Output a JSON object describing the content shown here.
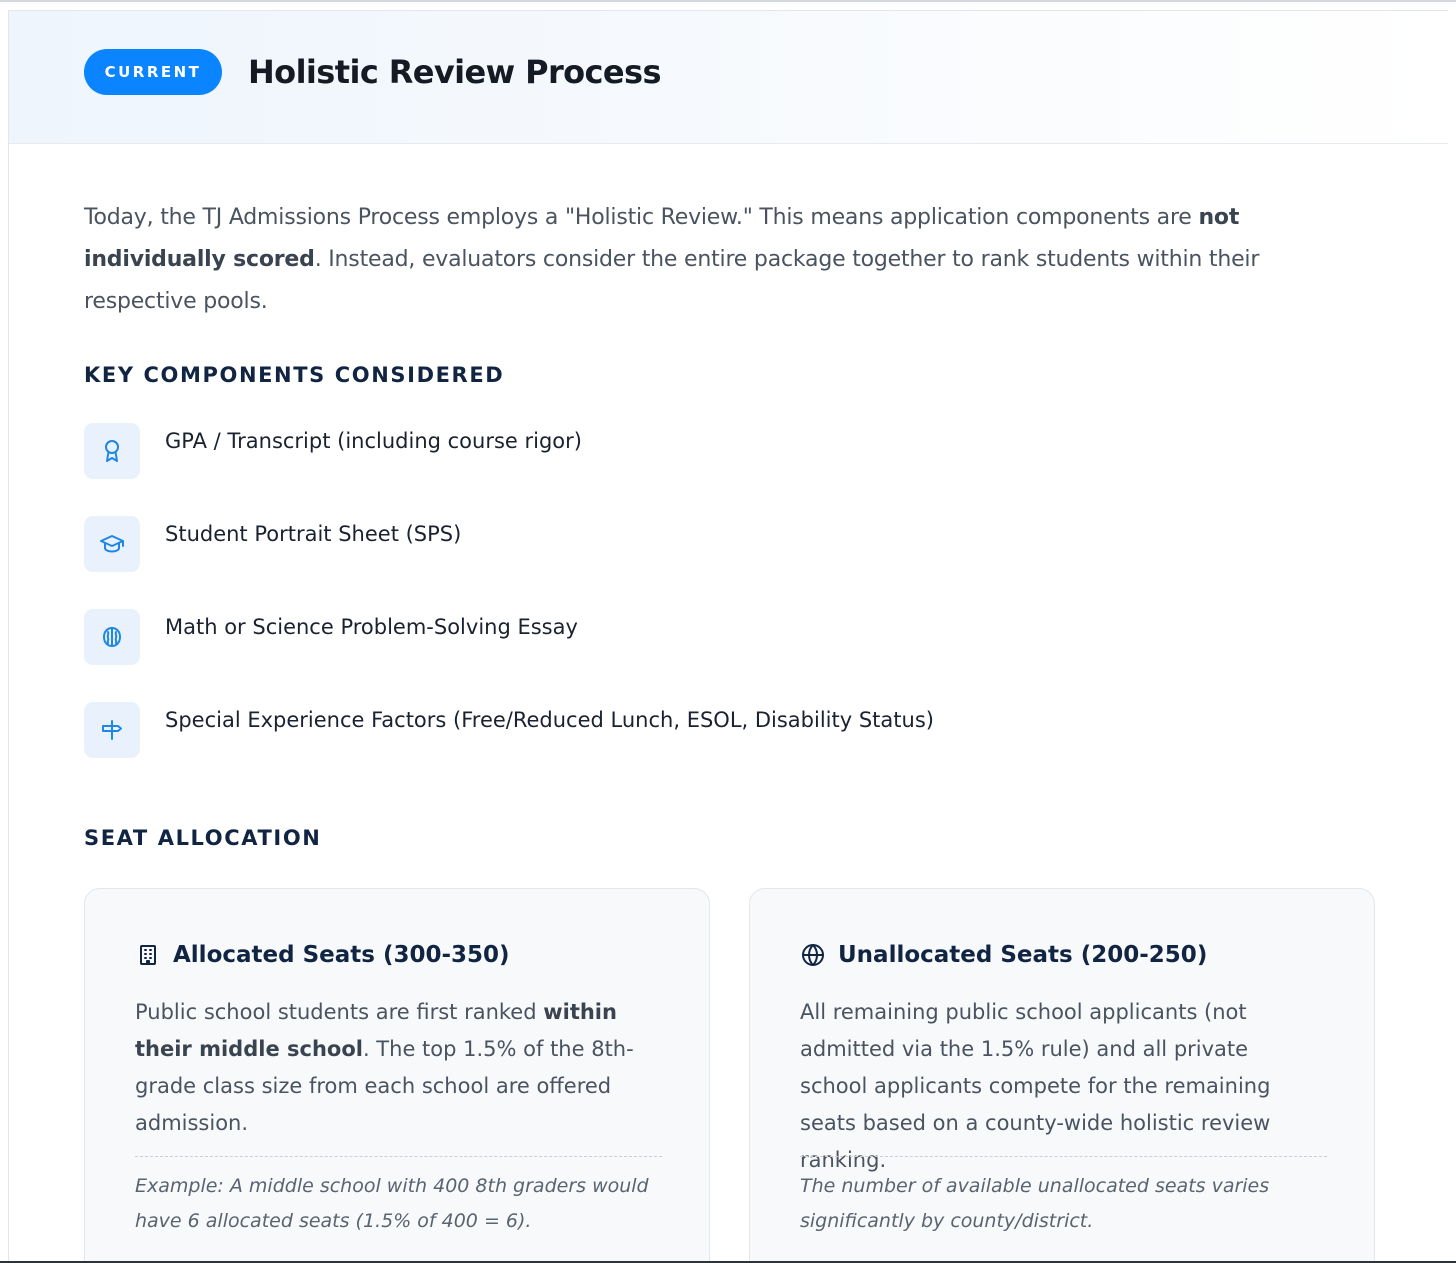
{
  "header": {
    "badge": "CURRENT",
    "title": "Holistic Review Process"
  },
  "intro": {
    "part1": "Today, the TJ Admissions Process employs a \"Holistic Review.\" This means application components are ",
    "bold": "not individually scored",
    "part2": ". Instead, evaluators consider the entire package together to rank students within their respective pools."
  },
  "key_components": {
    "heading": "KEY COMPONENTS CONSIDERED",
    "items": [
      {
        "icon": "award-ribbon-icon",
        "label": "GPA / Transcript (including course rigor)"
      },
      {
        "icon": "graduation-cap-icon",
        "label": "Student Portrait Sheet (SPS)"
      },
      {
        "icon": "brain-icon",
        "label": "Math or Science Problem-Solving Essay"
      },
      {
        "icon": "signpost-icon",
        "label": "Special Experience Factors (Free/Reduced Lunch, ESOL, Disability Status)"
      }
    ]
  },
  "seat_allocation": {
    "heading": "SEAT ALLOCATION",
    "allocated": {
      "icon": "building-icon",
      "title": "Allocated Seats (300-350)",
      "desc_part1": "Public school students are first ranked ",
      "desc_bold": "within their middle school",
      "desc_part2": ". The top 1.5% of the 8th-grade class size from each school are offered admission.",
      "note": "Example: A middle school with 400 8th graders would have 6 allocated seats (1.5% of 400 = 6)."
    },
    "unallocated": {
      "icon": "globe-icon",
      "title": "Unallocated Seats (200-250)",
      "desc": "All remaining public school applicants (not admitted via the 1.5% rule) and all private school applicants compete for the remaining seats based on a county-wide holistic review ranking.",
      "note": "The number of available unallocated seats varies significantly by county/district."
    }
  },
  "colors": {
    "accent": "#0a84ff",
    "heading": "#112543",
    "icon_bg": "#e9f2fc",
    "body_text": "#4a5360"
  }
}
